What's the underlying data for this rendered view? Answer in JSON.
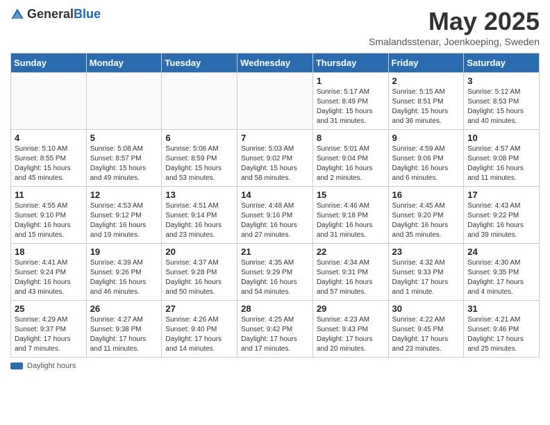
{
  "header": {
    "logo_general": "General",
    "logo_blue": "Blue",
    "title": "May 2025",
    "subtitle": "Smalandsstenar, Joenkoeping, Sweden"
  },
  "days_of_week": [
    "Sunday",
    "Monday",
    "Tuesday",
    "Wednesday",
    "Thursday",
    "Friday",
    "Saturday"
  ],
  "legend_label": "Daylight hours",
  "weeks": [
    [
      {
        "day": "",
        "info": ""
      },
      {
        "day": "",
        "info": ""
      },
      {
        "day": "",
        "info": ""
      },
      {
        "day": "",
        "info": ""
      },
      {
        "day": "1",
        "info": "Sunrise: 5:17 AM\nSunset: 8:49 PM\nDaylight: 15 hours\nand 31 minutes."
      },
      {
        "day": "2",
        "info": "Sunrise: 5:15 AM\nSunset: 8:51 PM\nDaylight: 15 hours\nand 36 minutes."
      },
      {
        "day": "3",
        "info": "Sunrise: 5:12 AM\nSunset: 8:53 PM\nDaylight: 15 hours\nand 40 minutes."
      }
    ],
    [
      {
        "day": "4",
        "info": "Sunrise: 5:10 AM\nSunset: 8:55 PM\nDaylight: 15 hours\nand 45 minutes."
      },
      {
        "day": "5",
        "info": "Sunrise: 5:08 AM\nSunset: 8:57 PM\nDaylight: 15 hours\nand 49 minutes."
      },
      {
        "day": "6",
        "info": "Sunrise: 5:06 AM\nSunset: 8:59 PM\nDaylight: 15 hours\nand 53 minutes."
      },
      {
        "day": "7",
        "info": "Sunrise: 5:03 AM\nSunset: 9:02 PM\nDaylight: 15 hours\nand 58 minutes."
      },
      {
        "day": "8",
        "info": "Sunrise: 5:01 AM\nSunset: 9:04 PM\nDaylight: 16 hours\nand 2 minutes."
      },
      {
        "day": "9",
        "info": "Sunrise: 4:59 AM\nSunset: 9:06 PM\nDaylight: 16 hours\nand 6 minutes."
      },
      {
        "day": "10",
        "info": "Sunrise: 4:57 AM\nSunset: 9:08 PM\nDaylight: 16 hours\nand 11 minutes."
      }
    ],
    [
      {
        "day": "11",
        "info": "Sunrise: 4:55 AM\nSunset: 9:10 PM\nDaylight: 16 hours\nand 15 minutes."
      },
      {
        "day": "12",
        "info": "Sunrise: 4:53 AM\nSunset: 9:12 PM\nDaylight: 16 hours\nand 19 minutes."
      },
      {
        "day": "13",
        "info": "Sunrise: 4:51 AM\nSunset: 9:14 PM\nDaylight: 16 hours\nand 23 minutes."
      },
      {
        "day": "14",
        "info": "Sunrise: 4:48 AM\nSunset: 9:16 PM\nDaylight: 16 hours\nand 27 minutes."
      },
      {
        "day": "15",
        "info": "Sunrise: 4:46 AM\nSunset: 9:18 PM\nDaylight: 16 hours\nand 31 minutes."
      },
      {
        "day": "16",
        "info": "Sunrise: 4:45 AM\nSunset: 9:20 PM\nDaylight: 16 hours\nand 35 minutes."
      },
      {
        "day": "17",
        "info": "Sunrise: 4:43 AM\nSunset: 9:22 PM\nDaylight: 16 hours\nand 39 minutes."
      }
    ],
    [
      {
        "day": "18",
        "info": "Sunrise: 4:41 AM\nSunset: 9:24 PM\nDaylight: 16 hours\nand 43 minutes."
      },
      {
        "day": "19",
        "info": "Sunrise: 4:39 AM\nSunset: 9:26 PM\nDaylight: 16 hours\nand 46 minutes."
      },
      {
        "day": "20",
        "info": "Sunrise: 4:37 AM\nSunset: 9:28 PM\nDaylight: 16 hours\nand 50 minutes."
      },
      {
        "day": "21",
        "info": "Sunrise: 4:35 AM\nSunset: 9:29 PM\nDaylight: 16 hours\nand 54 minutes."
      },
      {
        "day": "22",
        "info": "Sunrise: 4:34 AM\nSunset: 9:31 PM\nDaylight: 16 hours\nand 57 minutes."
      },
      {
        "day": "23",
        "info": "Sunrise: 4:32 AM\nSunset: 9:33 PM\nDaylight: 17 hours\nand 1 minute."
      },
      {
        "day": "24",
        "info": "Sunrise: 4:30 AM\nSunset: 9:35 PM\nDaylight: 17 hours\nand 4 minutes."
      }
    ],
    [
      {
        "day": "25",
        "info": "Sunrise: 4:29 AM\nSunset: 9:37 PM\nDaylight: 17 hours\nand 7 minutes."
      },
      {
        "day": "26",
        "info": "Sunrise: 4:27 AM\nSunset: 9:38 PM\nDaylight: 17 hours\nand 11 minutes."
      },
      {
        "day": "27",
        "info": "Sunrise: 4:26 AM\nSunset: 9:40 PM\nDaylight: 17 hours\nand 14 minutes."
      },
      {
        "day": "28",
        "info": "Sunrise: 4:25 AM\nSunset: 9:42 PM\nDaylight: 17 hours\nand 17 minutes."
      },
      {
        "day": "29",
        "info": "Sunrise: 4:23 AM\nSunset: 9:43 PM\nDaylight: 17 hours\nand 20 minutes."
      },
      {
        "day": "30",
        "info": "Sunrise: 4:22 AM\nSunset: 9:45 PM\nDaylight: 17 hours\nand 23 minutes."
      },
      {
        "day": "31",
        "info": "Sunrise: 4:21 AM\nSunset: 9:46 PM\nDaylight: 17 hours\nand 25 minutes."
      }
    ]
  ]
}
